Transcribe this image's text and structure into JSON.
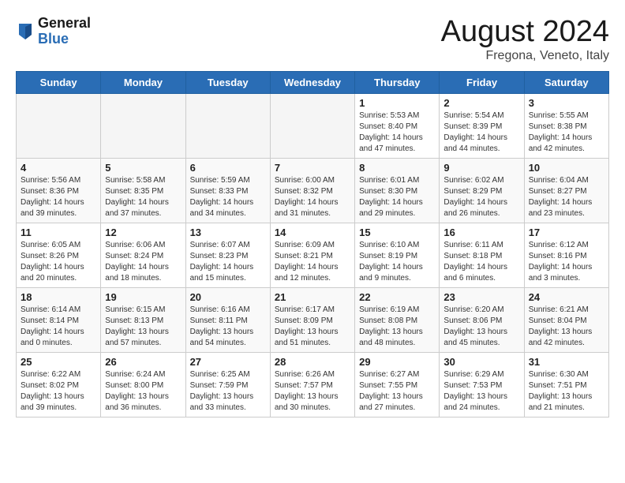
{
  "logo": {
    "line1": "General",
    "line2": "Blue"
  },
  "title": "August 2024",
  "subtitle": "Fregona, Veneto, Italy",
  "weekdays": [
    "Sunday",
    "Monday",
    "Tuesday",
    "Wednesday",
    "Thursday",
    "Friday",
    "Saturday"
  ],
  "weeks": [
    [
      {
        "day": "",
        "info": ""
      },
      {
        "day": "",
        "info": ""
      },
      {
        "day": "",
        "info": ""
      },
      {
        "day": "",
        "info": ""
      },
      {
        "day": "1",
        "info": "Sunrise: 5:53 AM\nSunset: 8:40 PM\nDaylight: 14 hours and 47 minutes."
      },
      {
        "day": "2",
        "info": "Sunrise: 5:54 AM\nSunset: 8:39 PM\nDaylight: 14 hours and 44 minutes."
      },
      {
        "day": "3",
        "info": "Sunrise: 5:55 AM\nSunset: 8:38 PM\nDaylight: 14 hours and 42 minutes."
      }
    ],
    [
      {
        "day": "4",
        "info": "Sunrise: 5:56 AM\nSunset: 8:36 PM\nDaylight: 14 hours and 39 minutes."
      },
      {
        "day": "5",
        "info": "Sunrise: 5:58 AM\nSunset: 8:35 PM\nDaylight: 14 hours and 37 minutes."
      },
      {
        "day": "6",
        "info": "Sunrise: 5:59 AM\nSunset: 8:33 PM\nDaylight: 14 hours and 34 minutes."
      },
      {
        "day": "7",
        "info": "Sunrise: 6:00 AM\nSunset: 8:32 PM\nDaylight: 14 hours and 31 minutes."
      },
      {
        "day": "8",
        "info": "Sunrise: 6:01 AM\nSunset: 8:30 PM\nDaylight: 14 hours and 29 minutes."
      },
      {
        "day": "9",
        "info": "Sunrise: 6:02 AM\nSunset: 8:29 PM\nDaylight: 14 hours and 26 minutes."
      },
      {
        "day": "10",
        "info": "Sunrise: 6:04 AM\nSunset: 8:27 PM\nDaylight: 14 hours and 23 minutes."
      }
    ],
    [
      {
        "day": "11",
        "info": "Sunrise: 6:05 AM\nSunset: 8:26 PM\nDaylight: 14 hours and 20 minutes."
      },
      {
        "day": "12",
        "info": "Sunrise: 6:06 AM\nSunset: 8:24 PM\nDaylight: 14 hours and 18 minutes."
      },
      {
        "day": "13",
        "info": "Sunrise: 6:07 AM\nSunset: 8:23 PM\nDaylight: 14 hours and 15 minutes."
      },
      {
        "day": "14",
        "info": "Sunrise: 6:09 AM\nSunset: 8:21 PM\nDaylight: 14 hours and 12 minutes."
      },
      {
        "day": "15",
        "info": "Sunrise: 6:10 AM\nSunset: 8:19 PM\nDaylight: 14 hours and 9 minutes."
      },
      {
        "day": "16",
        "info": "Sunrise: 6:11 AM\nSunset: 8:18 PM\nDaylight: 14 hours and 6 minutes."
      },
      {
        "day": "17",
        "info": "Sunrise: 6:12 AM\nSunset: 8:16 PM\nDaylight: 14 hours and 3 minutes."
      }
    ],
    [
      {
        "day": "18",
        "info": "Sunrise: 6:14 AM\nSunset: 8:14 PM\nDaylight: 14 hours and 0 minutes."
      },
      {
        "day": "19",
        "info": "Sunrise: 6:15 AM\nSunset: 8:13 PM\nDaylight: 13 hours and 57 minutes."
      },
      {
        "day": "20",
        "info": "Sunrise: 6:16 AM\nSunset: 8:11 PM\nDaylight: 13 hours and 54 minutes."
      },
      {
        "day": "21",
        "info": "Sunrise: 6:17 AM\nSunset: 8:09 PM\nDaylight: 13 hours and 51 minutes."
      },
      {
        "day": "22",
        "info": "Sunrise: 6:19 AM\nSunset: 8:08 PM\nDaylight: 13 hours and 48 minutes."
      },
      {
        "day": "23",
        "info": "Sunrise: 6:20 AM\nSunset: 8:06 PM\nDaylight: 13 hours and 45 minutes."
      },
      {
        "day": "24",
        "info": "Sunrise: 6:21 AM\nSunset: 8:04 PM\nDaylight: 13 hours and 42 minutes."
      }
    ],
    [
      {
        "day": "25",
        "info": "Sunrise: 6:22 AM\nSunset: 8:02 PM\nDaylight: 13 hours and 39 minutes."
      },
      {
        "day": "26",
        "info": "Sunrise: 6:24 AM\nSunset: 8:00 PM\nDaylight: 13 hours and 36 minutes."
      },
      {
        "day": "27",
        "info": "Sunrise: 6:25 AM\nSunset: 7:59 PM\nDaylight: 13 hours and 33 minutes."
      },
      {
        "day": "28",
        "info": "Sunrise: 6:26 AM\nSunset: 7:57 PM\nDaylight: 13 hours and 30 minutes."
      },
      {
        "day": "29",
        "info": "Sunrise: 6:27 AM\nSunset: 7:55 PM\nDaylight: 13 hours and 27 minutes."
      },
      {
        "day": "30",
        "info": "Sunrise: 6:29 AM\nSunset: 7:53 PM\nDaylight: 13 hours and 24 minutes."
      },
      {
        "day": "31",
        "info": "Sunrise: 6:30 AM\nSunset: 7:51 PM\nDaylight: 13 hours and 21 minutes."
      }
    ]
  ]
}
